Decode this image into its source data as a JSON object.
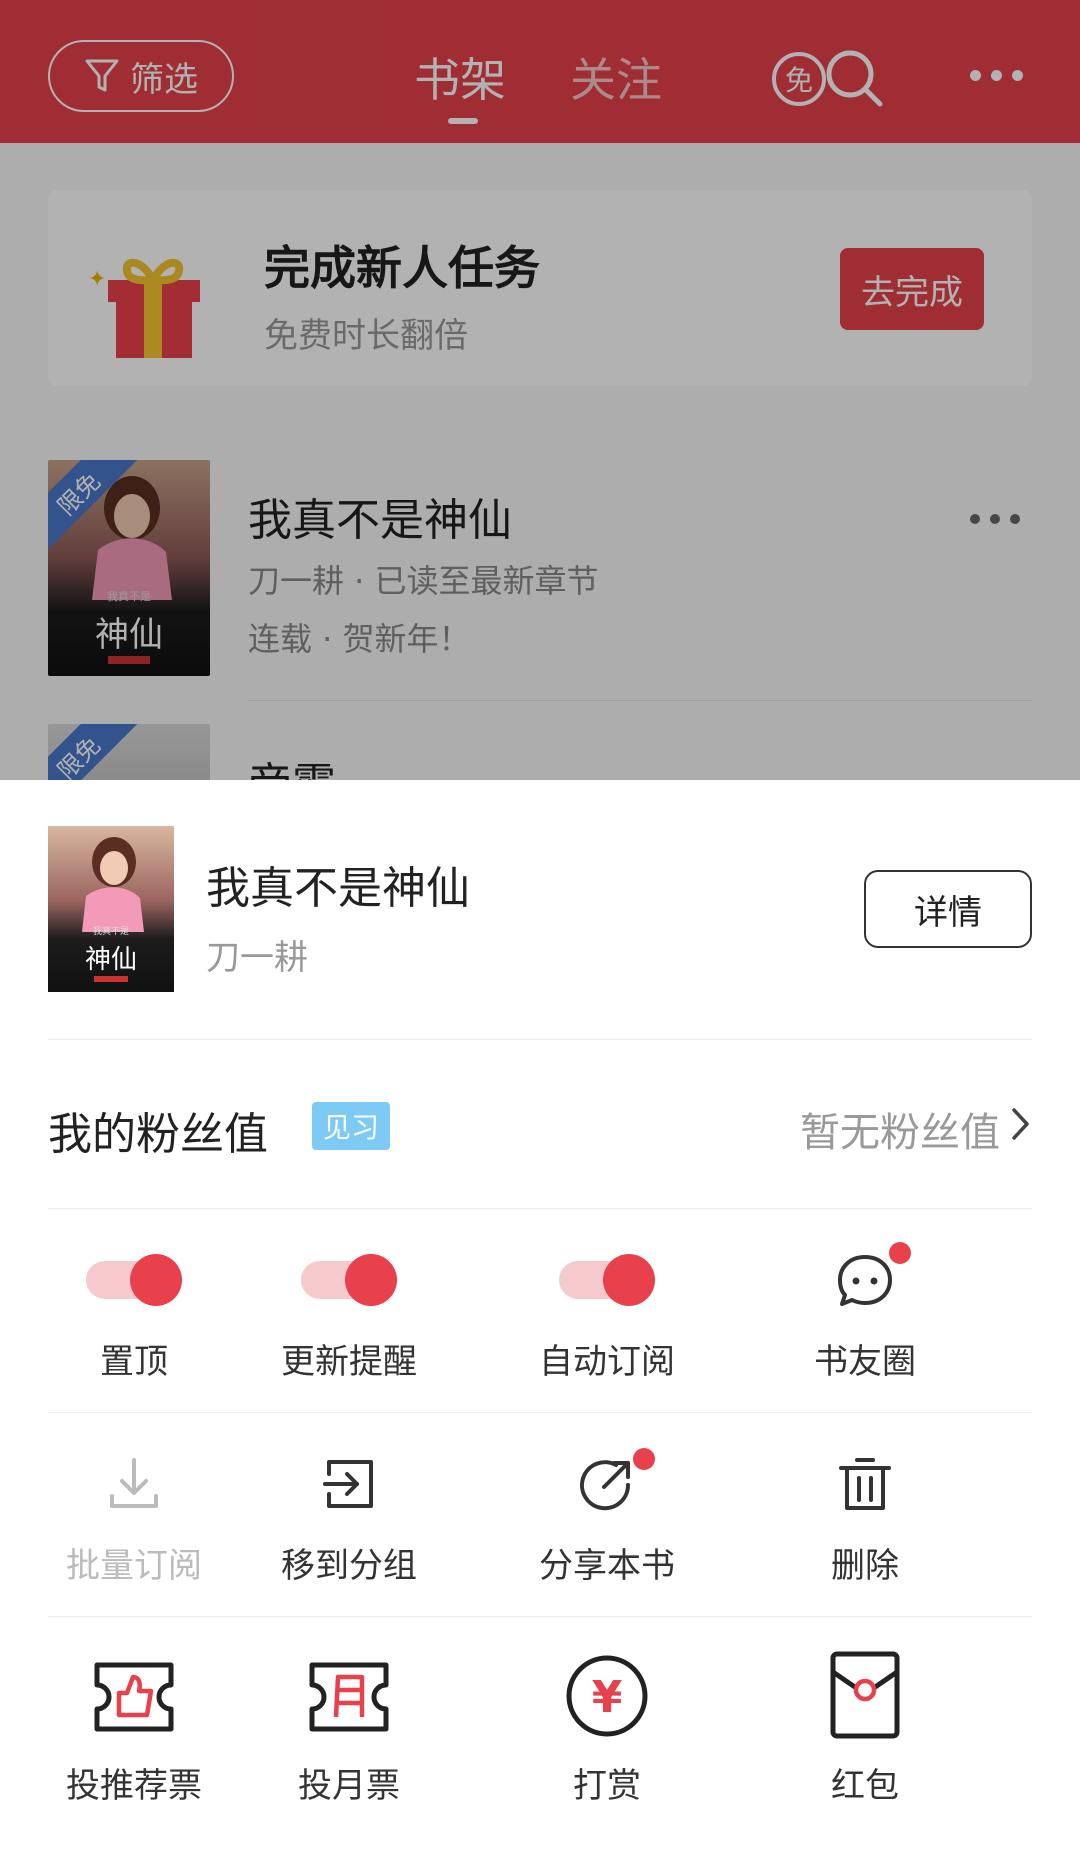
{
  "header": {
    "filter_label": "筛选",
    "tabs": [
      {
        "label": "书架",
        "active": true
      },
      {
        "label": "关注",
        "active": false
      }
    ],
    "free_icon_char": "免"
  },
  "task_card": {
    "title": "完成新人任务",
    "subtitle": "免费时长翻倍",
    "button_label": "去完成"
  },
  "shelf_books": [
    {
      "badge": "限免",
      "title": "我真不是神仙",
      "meta1": "刀一耕 · 已读至最新章节",
      "meta2": "连载 · 贺新年！"
    },
    {
      "badge": "限免",
      "title": "帝霸"
    }
  ],
  "cover_art": {
    "caption": "神仙",
    "small_text": "我真不是"
  },
  "sheet": {
    "title": "我真不是神仙",
    "author": "刀一耕",
    "detail_button": "详情",
    "fans": {
      "label": "我的粉丝值",
      "badge": "见习",
      "status": "暂无粉丝值"
    },
    "row1": [
      {
        "label": "置顶",
        "type": "toggle",
        "on": true
      },
      {
        "label": "更新提醒",
        "type": "toggle",
        "on": true
      },
      {
        "label": "自动订阅",
        "type": "toggle",
        "on": true
      },
      {
        "label": "书友圈",
        "icon": "chat-bubble-icon",
        "dot": true
      }
    ],
    "row2": [
      {
        "label": "批量订阅",
        "icon": "download-icon",
        "disabled": true
      },
      {
        "label": "移到分组",
        "icon": "move-to-group-icon"
      },
      {
        "label": "分享本书",
        "icon": "share-icon",
        "dot": true
      },
      {
        "label": "删除",
        "icon": "trash-icon"
      }
    ],
    "row3": [
      {
        "label": "投推荐票",
        "icon": "recommend-ticket-icon"
      },
      {
        "label": "投月票",
        "icon": "monthly-ticket-icon"
      },
      {
        "label": "打赏",
        "icon": "reward-yuan-icon",
        "glyph": "¥"
      },
      {
        "label": "红包",
        "icon": "red-packet-icon"
      }
    ]
  },
  "colors": {
    "brand_red": "#e4414a",
    "toggle_track": "#f6c9cc",
    "badge_blue": "#7dcbf5"
  }
}
